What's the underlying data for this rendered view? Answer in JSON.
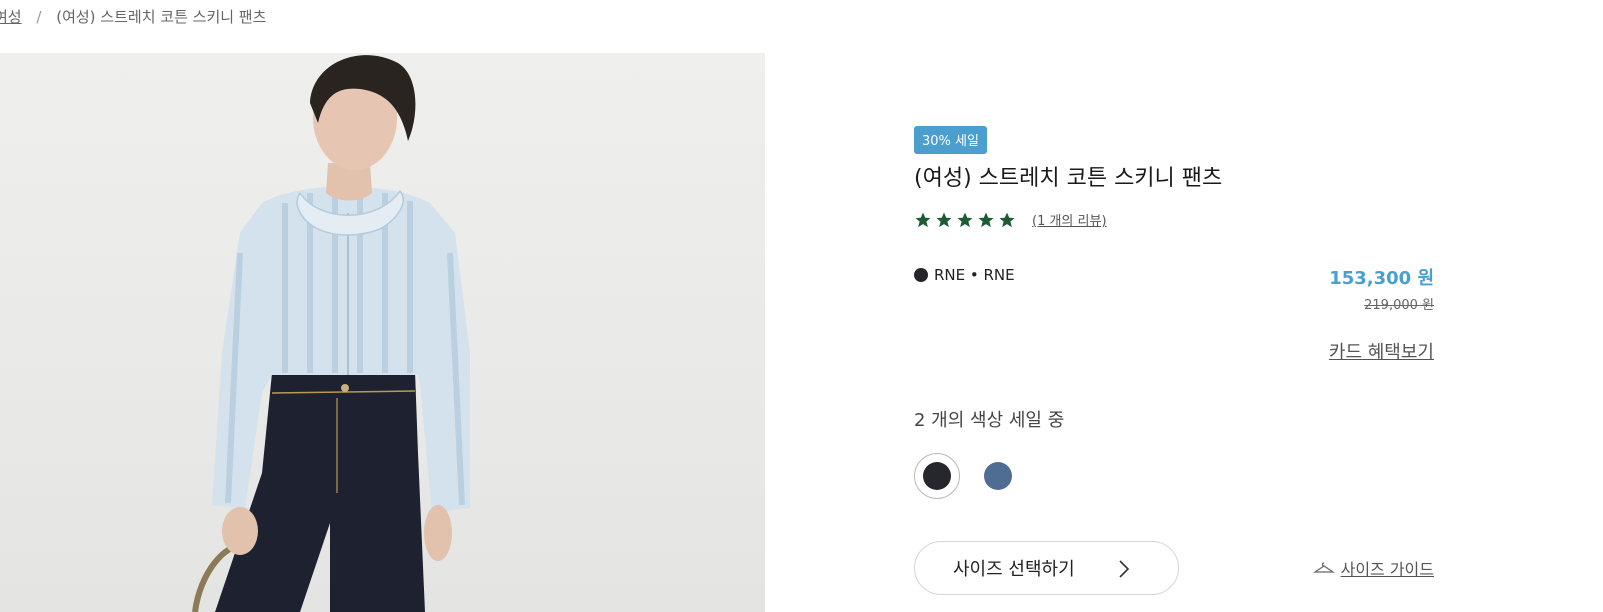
{
  "breadcrumb": {
    "parent": "여성",
    "separator": "/",
    "current": "(여성) 스트레치 코튼 스키니 팬츠"
  },
  "product": {
    "badge": "30% 세일",
    "title": "(여성) 스트레치 코튼 스키니 팬츠",
    "rating": 5,
    "rating_max": 5,
    "reviews_label": "(1 개의 리뷰)",
    "color_label": "RNE • RNE",
    "price_sale": "153,300 원",
    "price_original": "219,000 원",
    "card_benefits": "카드 혜택보기",
    "colors_on_sale": "2 개의 색상 세일 중",
    "swatches": [
      {
        "color": "#26272c",
        "selected": true
      },
      {
        "color": "#4f6c92",
        "selected": false
      }
    ],
    "size_select": "사이즈 선택하기",
    "size_guide": "사이즈 가이드"
  },
  "colors": {
    "accent": "#4a9fcf",
    "star": "#1c5b34",
    "text": "#222222"
  },
  "icons": [
    "star-icon",
    "chevron-right-icon",
    "hanger-icon"
  ]
}
